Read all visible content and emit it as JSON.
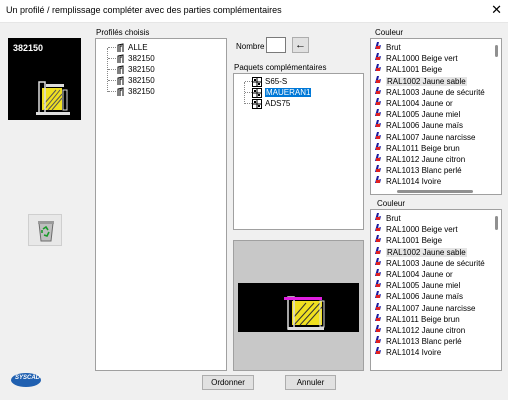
{
  "window": {
    "title": "Un profilé / remplissage compléter avec des parties complémentaires",
    "close_label": "✕"
  },
  "preview": {
    "code": "382150"
  },
  "chosen_profiles": {
    "label": "Profilés choisis",
    "items": [
      "ALLE",
      "382150",
      "382150",
      "382150",
      "382150"
    ]
  },
  "number": {
    "label": "Nombre",
    "value": "",
    "arrow": "←"
  },
  "packages": {
    "label": "Paquets complémentaires",
    "items": [
      "S65-S",
      "MAUERAN1",
      "ADS75"
    ],
    "selected": "MAUERAN1"
  },
  "color1": {
    "label": "Couleur",
    "items": [
      "Brut",
      "RAL1000 Beige vert",
      "RAL1001 Beige",
      "RAL1002 Jaune sable",
      "RAL1003 Jaune de sécurité",
      "RAL1004 Jaune or",
      "RAL1005 Jaune miel",
      "RAL1006 Jaune maïs",
      "RAL1007 Jaune narcisse",
      "RAL1011 Beige brun",
      "RAL1012 Jaune citron",
      "RAL1013 Blanc perlé",
      "RAL1014 Ivoire"
    ],
    "highlighted": "RAL1002 Jaune sable"
  },
  "color2": {
    "label": "Couleur",
    "items": [
      "Brut",
      "RAL1000 Beige vert",
      "RAL1001 Beige",
      "RAL1002 Jaune sable",
      "RAL1003 Jaune de sécurité",
      "RAL1004 Jaune or",
      "RAL1005 Jaune miel",
      "RAL1006 Jaune maïs",
      "RAL1007 Jaune narcisse",
      "RAL1011 Beige brun",
      "RAL1012 Jaune citron",
      "RAL1013 Blanc perlé",
      "RAL1014 Ivoire"
    ],
    "highlighted": "RAL1002 Jaune sable"
  },
  "buttons": {
    "order": "Ordonner",
    "cancel": "Annuler"
  },
  "logo": {
    "text": "SYSCAD"
  },
  "colors": {
    "accent": "#0078d7",
    "preview_bg": "#000000",
    "profile_yellow": "#f0e020",
    "magenta": "#e020e0"
  }
}
